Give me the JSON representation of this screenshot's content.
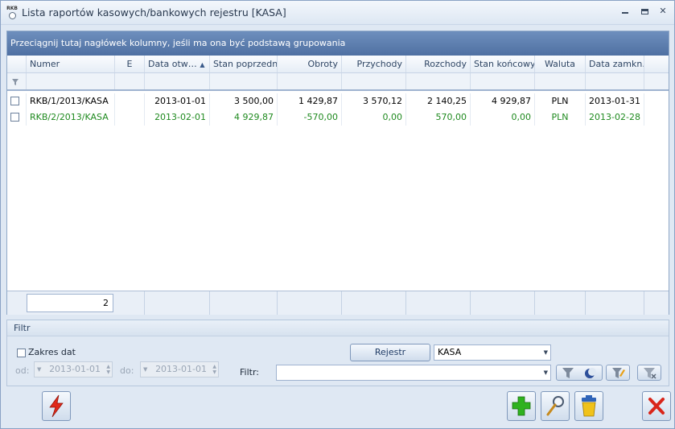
{
  "window": {
    "title": "Lista raportów kasowych/bankowych rejestru [KASA]",
    "app_icon": "RKB"
  },
  "grid": {
    "group_hint": "Przeciągnij tutaj nagłówek kolumny, jeśli ma ona być podstawą grupowania",
    "columns": [
      "Numer",
      "E",
      "Data otw…",
      "Stan poprzedni",
      "Obroty",
      "Przychody",
      "Rozchody",
      "Stan końcowy",
      "Waluta",
      "Data zamkn."
    ],
    "rows": [
      {
        "numer": "RKB/1/2013/KASA",
        "e": "",
        "data_otw": "2013-01-01",
        "stan_poprzedni": "3 500,00",
        "obroty": "1 429,87",
        "przychody": "3 570,12",
        "rozchody": "2 140,25",
        "stan_koncowy": "4 929,87",
        "waluta": "PLN",
        "data_zamkn": "2013-01-31"
      },
      {
        "numer": "RKB/2/2013/KASA",
        "e": "",
        "data_otw": "2013-02-01",
        "stan_poprzedni": "4 929,87",
        "obroty": "-570,00",
        "przychody": "0,00",
        "rozchody": "570,00",
        "stan_koncowy": "0,00",
        "waluta": "PLN",
        "data_zamkn": "2013-02-28"
      }
    ],
    "count": "2",
    "row_colors": {
      "closed": "#000000",
      "open": "#1f8a1f"
    }
  },
  "filter": {
    "title": "Filtr",
    "zakres_label": "Zakres dat",
    "od_label": "od:",
    "do_label": "do:",
    "od_value": "2013-01-01",
    "do_value": "2013-01-01",
    "rejestr_label": "Rejestr",
    "rejestr_value": "KASA",
    "filtr_label": "Filtr:",
    "filtr_value": ""
  },
  "icons": [
    "lightning-icon",
    "plus-icon",
    "magnifier-icon",
    "trash-icon",
    "close-x-icon",
    "funnel-icon"
  ]
}
